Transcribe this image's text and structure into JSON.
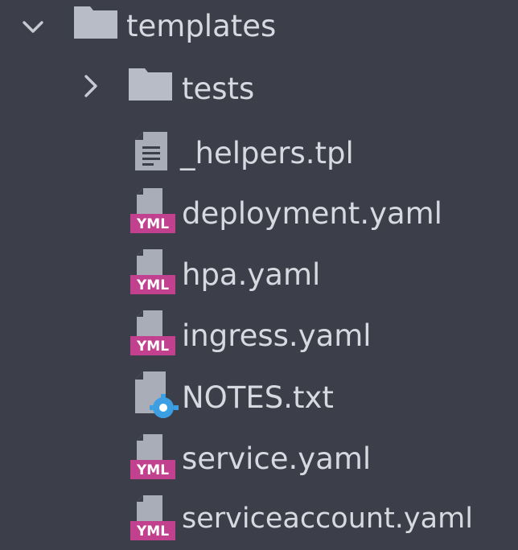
{
  "tree": {
    "root": {
      "label": "templates",
      "expanded": true,
      "icon": "folder-icon",
      "chevron": "chevron-down-icon"
    },
    "items": [
      {
        "label": "tests",
        "kind": "folder",
        "expanded": false,
        "icon": "folder-icon",
        "chevron": "chevron-right-icon"
      },
      {
        "label": "_helpers.tpl",
        "kind": "text-file",
        "icon": "text-file-icon"
      },
      {
        "label": "deployment.yaml",
        "kind": "yaml",
        "icon": "yaml-file-icon",
        "badge": "YML"
      },
      {
        "label": "hpa.yaml",
        "kind": "yaml",
        "icon": "yaml-file-icon",
        "badge": "YML"
      },
      {
        "label": "ingress.yaml",
        "kind": "yaml",
        "icon": "yaml-file-icon",
        "badge": "YML"
      },
      {
        "label": "NOTES.txt",
        "kind": "config-text",
        "icon": "text-file-gear-icon"
      },
      {
        "label": "service.yaml",
        "kind": "yaml",
        "icon": "yaml-file-icon",
        "badge": "YML"
      },
      {
        "label": "serviceaccount.yaml",
        "kind": "yaml",
        "icon": "yaml-file-icon",
        "badge": "YML"
      }
    ]
  },
  "colors": {
    "background": "#3c3f4a",
    "text": "#d7d9e0",
    "folder": "#b8bcc6",
    "file": "#a9adb7",
    "yaml_badge": "#c2418f",
    "gear": "#3c9fe3"
  }
}
